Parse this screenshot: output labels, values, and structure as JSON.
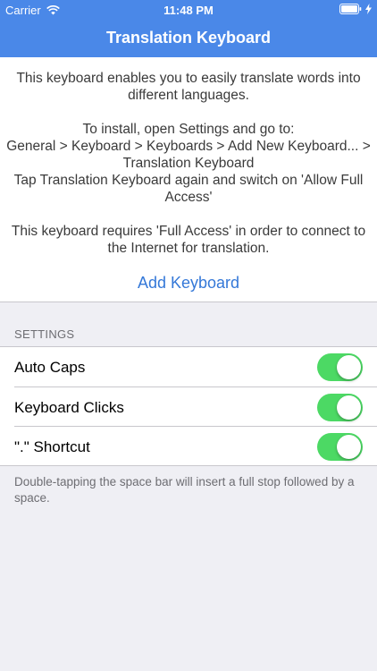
{
  "status_bar": {
    "carrier": "Carrier",
    "time": "11:48 PM",
    "wifi_icon": "wifi-icon",
    "battery_icon": "battery-icon",
    "charging_icon": "bolt-icon"
  },
  "nav": {
    "title": "Translation Keyboard",
    "bar_color": "#4a88e8"
  },
  "info": {
    "intro": "This keyboard enables you to easily translate words into\ndifferent languages.",
    "install_title": "To install, open Settings and go to:",
    "install_path": "General > Keyboard > Keyboards > Add New Keyboard... >\nTranslation Keyboard",
    "install_step": "Tap Translation Keyboard again and switch on 'Allow Full\nAccess'",
    "access_note": "This keyboard requires 'Full Access' in order to connect to\nthe Internet for translation."
  },
  "add_keyboard_label": "Add Keyboard",
  "settings": {
    "header": "SETTINGS",
    "rows": [
      {
        "label": "Auto Caps",
        "on": true
      },
      {
        "label": "Keyboard Clicks",
        "on": true
      },
      {
        "label": "\".\" Shortcut",
        "on": true
      }
    ],
    "toggle_on_color": "#4cd964",
    "footer": "Double-tapping the space bar will insert a full stop followed by a space."
  }
}
